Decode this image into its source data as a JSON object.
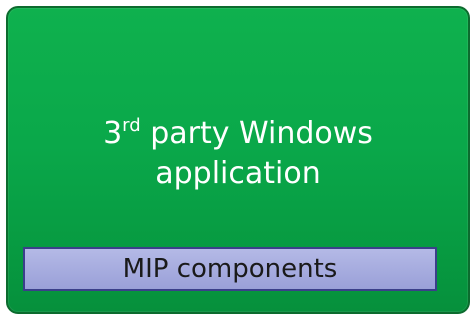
{
  "app_box": {
    "title_prefix": "3",
    "title_superscript": "rd",
    "title_line1_rest": " party Windows",
    "title_line2": "application",
    "fill_color": "#0aa84a",
    "border_color": "#0c6b2e"
  },
  "mip_box": {
    "label": "MIP components",
    "fill_color": "#a6acdd",
    "border_color": "#3b3f8a"
  }
}
